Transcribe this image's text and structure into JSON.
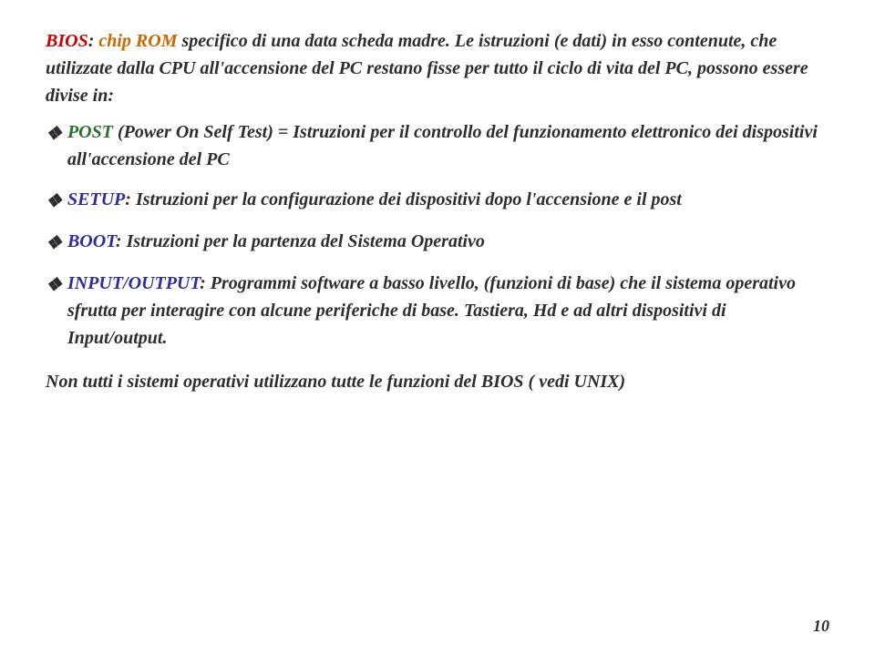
{
  "page": {
    "background": "#ffffff",
    "number": "10"
  },
  "intro": {
    "bios_label": "BIOS",
    "colon": ":",
    "chip_rom": " chip ROM",
    "rest_1": " specifico di una data scheda madre. Le istruzioni (e dati) in esso contenute, che utilizzate dalla CPU all'accensione del PC restano fisse per tutto il ciclo di vita del PC, possono essere divise in:"
  },
  "bullets": [
    {
      "id": "post",
      "diamond": "❖",
      "term": "POST",
      "term_color": "#2d6e2d",
      "description": " (Power On Self Test) = Istruzioni per il controllo del funzionamento elettronico dei dispositivi all'accensione del PC"
    },
    {
      "id": "setup",
      "diamond": "❖",
      "term": "SETUP",
      "term_color": "#2d2d9e",
      "description": ": Istruzioni per la configurazione dei dispositivi dopo l'accensione e il post"
    },
    {
      "id": "boot",
      "diamond": "❖",
      "term": "BOOT",
      "term_color": "#2d2d9e",
      "description": ": Istruzioni per la partenza del Sistema Operativo"
    },
    {
      "id": "io",
      "diamond": "❖",
      "term": "INPUT/OUTPUT",
      "term_color": "#2d2d9e",
      "description": ": Programmi software a basso livello,",
      "description2": " (funzioni di base) che il sistema operativo sfrutta per interagire con alcune periferiche di base. Tastiera, Hd e ad altri dispositivi di Input/output."
    }
  ],
  "last_line": "Non tutti i sistemi operativi utilizzano tutte le funzioni del BIOS ( vedi UNIX)"
}
